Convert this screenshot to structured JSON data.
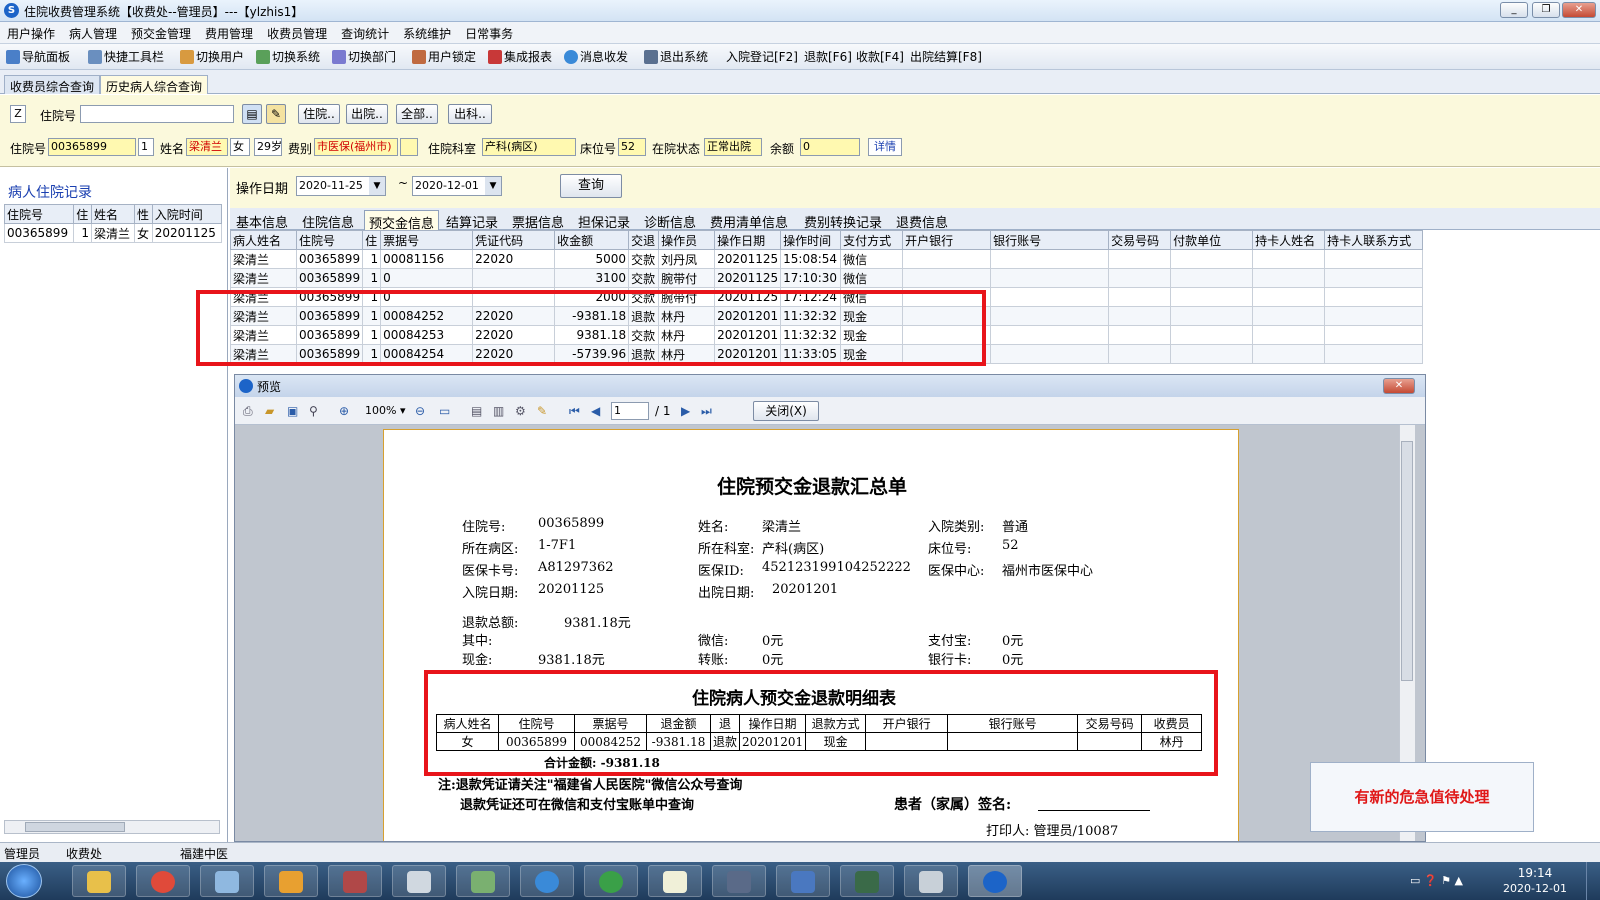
{
  "window": {
    "title": "住院收费管理系统【收费处--管理员】---【ylzhis1】"
  },
  "menu": [
    "用户操作",
    "病人管理",
    "预交金管理",
    "费用管理",
    "收费员管理",
    "查询统计",
    "系统维护",
    "日常事务"
  ],
  "toolbar": [
    "导航面板",
    "快捷工具栏",
    "切换用户",
    "切换系统",
    "切换部门",
    "用户锁定",
    "集成报表",
    "消息收发",
    "退出系统",
    "入院登记[F2]",
    "退款[F6]",
    "收款[F4]",
    "出院结算[F8]"
  ],
  "main_tabs": [
    "收费员综合查询",
    "历史病人综合查询"
  ],
  "search": {
    "z_label": "Z",
    "inpatient_label": "住院号",
    "inpatient_value": "",
    "btn_admit": "住院..",
    "btn_discharge": "出院..",
    "btn_all": "全部..",
    "btn_dept": "出科.."
  },
  "patient": {
    "no_label": "住院号",
    "no": "00365899",
    "count": "1",
    "name_label": "姓名",
    "name": "梁清兰",
    "sex": "女",
    "age": "29岁",
    "fee_label": "费别",
    "fee": "市医保(福州市)",
    "dept_label": "住院科室",
    "dept": "产科(病区)",
    "bed_label": "床位号",
    "bed": "52",
    "status_label": "在院状态",
    "status": "正常出院",
    "balance_label": "余额",
    "balance": "0",
    "detail_btn": "详情"
  },
  "left": {
    "title": "病人住院记录",
    "headers": [
      "住院号",
      "住",
      "姓名",
      "性",
      "入院时间"
    ],
    "rows": [
      [
        "00365899",
        "1",
        "梁清兰",
        "女",
        "20201125"
      ]
    ]
  },
  "opdate": {
    "label": "操作日期",
    "from": "2020-11-25",
    "sep": "~",
    "to": "2020-12-01",
    "query_btn": "查询"
  },
  "sub_tabs": [
    "基本信息",
    "住院信息",
    "预交金信息",
    "结算记录",
    "票据信息",
    "担保记录",
    "诊断信息",
    "费用清单信息",
    "费别转换记录",
    "退费信息"
  ],
  "deposit_grid": {
    "headers": [
      "病人姓名",
      "住院号",
      "住",
      "票据号",
      "凭证代码",
      "收金额",
      "交退",
      "操作员",
      "操作日期",
      "操作时间",
      "支付方式",
      "开户银行",
      "银行账号",
      "交易号码",
      "付款单位",
      "持卡人姓名",
      "持卡人联系方式"
    ],
    "rows": [
      [
        "梁清兰",
        "00365899",
        "1",
        "00081156",
        "22020",
        "5000",
        "交款",
        "刘丹凤",
        "20201125",
        "15:08:54",
        "微信"
      ],
      [
        "梁清兰",
        "00365899",
        "1",
        "0",
        "",
        "3100",
        "交款",
        "腕带付",
        "20201125",
        "17:10:30",
        "微信"
      ],
      [
        "梁清兰",
        "00365899",
        "1",
        "0",
        "",
        "2000",
        "交款",
        "腕带付",
        "20201125",
        "17:12:24",
        "微信"
      ],
      [
        "梁清兰",
        "00365899",
        "1",
        "00084252",
        "22020",
        "-9381.18",
        "退款",
        "林丹",
        "20201201",
        "11:32:32",
        "现金"
      ],
      [
        "梁清兰",
        "00365899",
        "1",
        "00084253",
        "22020",
        "9381.18",
        "交款",
        "林丹",
        "20201201",
        "11:32:32",
        "现金"
      ],
      [
        "梁清兰",
        "00365899",
        "1",
        "00084254",
        "22020",
        "-5739.96",
        "退款",
        "林丹",
        "20201201",
        "11:33:05",
        "现金"
      ]
    ]
  },
  "preview": {
    "title": "预览",
    "zoom": "100%",
    "page": "1",
    "page_total": "/ 1",
    "close_btn": "关闭(X)",
    "doc": {
      "title": "住院预交金退款汇总单",
      "l1": "住院号:",
      "v1": "00365899",
      "l2": "姓名:",
      "v2": "梁清兰",
      "l3": "入院类别:",
      "v3": "普通",
      "l4": "所在病区:",
      "v4": "1-7F1",
      "l5": "所在科室:",
      "v5": "产科(病区)",
      "l6": "床位号:",
      "v6": "52",
      "l7": "医保卡号:",
      "v7": "A81297362",
      "l8": "医保ID:",
      "v8": "452123199104252222",
      "l9": "医保中心:",
      "v9": "福州市医保中心",
      "l10": "入院日期:",
      "v10": "20201125",
      "l11": "出院日期:",
      "v11": "20201201",
      "refund_total_label": "退款总额:",
      "refund_total": "9381.18元",
      "among": "其中:",
      "wechat_label": "微信:",
      "wechat": "0元",
      "alipay_label": "支付宝:",
      "alipay": "0元",
      "cash_label": "现金:",
      "cash": "9381.18元",
      "transfer_label": "转账:",
      "transfer": "0元",
      "bankcard_label": "银行卡:",
      "bankcard": "0元",
      "detail_title": "住院病人预交金退款明细表",
      "detail_headers": [
        "病人姓名",
        "住院号",
        "票据号",
        "退金额",
        "退",
        "操作日期",
        "退款方式",
        "开户银行",
        "银行账号",
        "交易号码",
        "收费员"
      ],
      "detail_row": [
        "女",
        "00365899",
        "00084252",
        "-9381.18",
        "退款",
        "20201201",
        "现金",
        "",
        "",
        "",
        "林丹"
      ],
      "sum": "合计金额: -9381.18",
      "note1": "注:退款凭证请关注\"福建省人民医院\"微信公众号查询",
      "note2": "退款凭证还可在微信和支付宝账单中查询",
      "sign": "患者（家属）签名:",
      "printer": "打印人: 管理员/10087"
    }
  },
  "alert": "有新的危急值待处理",
  "status": [
    "管理员",
    "收费处",
    "福建中医"
  ],
  "clock": {
    "time": "19:14",
    "date": "2020-12-01"
  }
}
